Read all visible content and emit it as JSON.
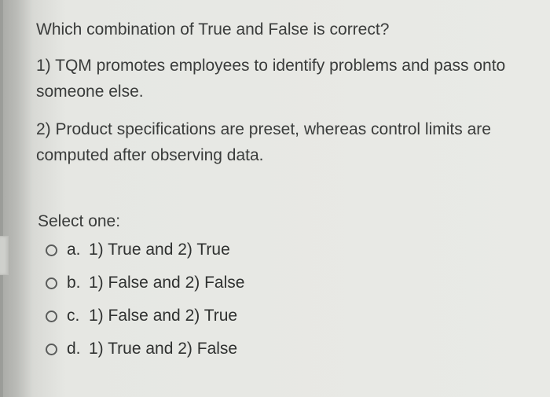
{
  "question": {
    "title": "Which combination of True and False is correct?",
    "statements": [
      "1) TQM promotes employees to identify problems and pass onto someone else.",
      "2) Product specifications are preset, whereas control limits are computed after observing data."
    ],
    "select_label": "Select one:",
    "options": [
      {
        "letter": "a.",
        "text": "1) True and 2) True"
      },
      {
        "letter": "b.",
        "text": "1) False and 2) False"
      },
      {
        "letter": "c.",
        "text": "1) False and 2) True"
      },
      {
        "letter": "d.",
        "text": "1) True and 2) False"
      }
    ]
  }
}
